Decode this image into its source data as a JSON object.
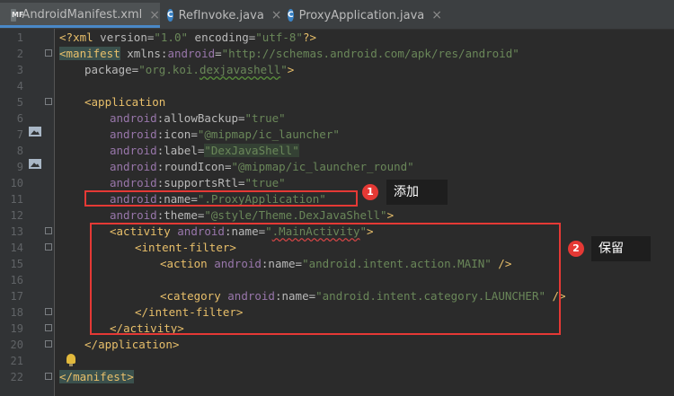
{
  "tabs": [
    {
      "label": "AndroidManifest.xml",
      "active": true,
      "icon": "manifest-xml-icon"
    },
    {
      "label": "RefInvoke.java",
      "active": false,
      "icon": "java-class-icon"
    },
    {
      "label": "ProxyApplication.java",
      "active": false,
      "icon": "java-class-icon"
    }
  ],
  "class_icon_letter": "C",
  "close_glyph": "×",
  "line_numbers": [
    "1",
    "2",
    "3",
    "4",
    "5",
    "6",
    "7",
    "8",
    "9",
    "10",
    "11",
    "12",
    "13",
    "14",
    "15",
    "16",
    "17",
    "18",
    "19",
    "20",
    "21",
    "22"
  ],
  "code": {
    "l1": {
      "open": "<?",
      "name": "xml",
      "a1": " version=",
      "v1": "\"1.0\"",
      "a2": " encoding=",
      "v2": "\"utf-8\"",
      "close": "?>"
    },
    "l2": {
      "open": "<",
      "name": "manifest",
      "attr": " xmlns:",
      "ns": "android",
      "eq": "=",
      "val": "\"http://schemas.android.com/apk/res/android\""
    },
    "l3": {
      "attr": "package=",
      "val_pre": "\"org.koi.",
      "val_sq": "dexjavashell",
      "val_post": "\"",
      "close": ">"
    },
    "l5": {
      "open": "<",
      "name": "application"
    },
    "l6": {
      "ns": "android",
      "attr": ":allowBackup=",
      "val": "\"true\""
    },
    "l7": {
      "ns": "android",
      "attr": ":icon=",
      "val": "\"@mipmap/ic_launcher\""
    },
    "l8": {
      "ns": "android",
      "attr": ":label=",
      "val": "\"DexJavaShell\""
    },
    "l9": {
      "ns": "android",
      "attr": ":roundIcon=",
      "val": "\"@mipmap/ic_launcher_round\""
    },
    "l10": {
      "ns": "android",
      "attr": ":supportsRtl=",
      "val": "\"true\""
    },
    "l11": {
      "ns": "android",
      "attr": ":name=",
      "val": "\".ProxyApplication\""
    },
    "l12": {
      "ns": "android",
      "attr": ":theme=",
      "val": "\"@style/Theme.DexJavaShell\"",
      "close": ">"
    },
    "l13": {
      "open": "<",
      "name": "activity",
      "ns": " android",
      "attr": ":name=",
      "val_q1": "\"",
      "val_sq": ".MainActivity",
      "val_q2": "\"",
      "close": ">"
    },
    "l14": {
      "open": "<",
      "name": "intent-filter",
      "close": ">"
    },
    "l15": {
      "open": "<",
      "name": "action",
      "ns": " android",
      "attr": ":name=",
      "val": "\"android.intent.action.MAIN\"",
      "close": " />"
    },
    "l17": {
      "open": "<",
      "name": "category",
      "ns": " android",
      "attr": ":name=",
      "val": "\"android.intent.category.LAUNCHER\"",
      "close": " />"
    },
    "l18": {
      "open": "</",
      "name": "intent-filter",
      "close": ">"
    },
    "l19": {
      "open": "</",
      "name": "activity",
      "close": ">"
    },
    "l20": {
      "open": "</",
      "name": "application",
      "close": ">"
    },
    "l22": {
      "open": "</",
      "name": "manifest",
      "close": ">"
    }
  },
  "annotations": [
    {
      "badge": "1",
      "text": "添加"
    },
    {
      "badge": "2",
      "text": "保留"
    }
  ],
  "gutter_icons": [
    "image-icon",
    "image-icon",
    "lightbulb-icon"
  ],
  "colors": {
    "editor_bg": "#2b2b2b",
    "tag": "#e8bf6a",
    "namespace": "#9876aa",
    "string": "#6a8759",
    "annotation_red": "#e53935"
  }
}
